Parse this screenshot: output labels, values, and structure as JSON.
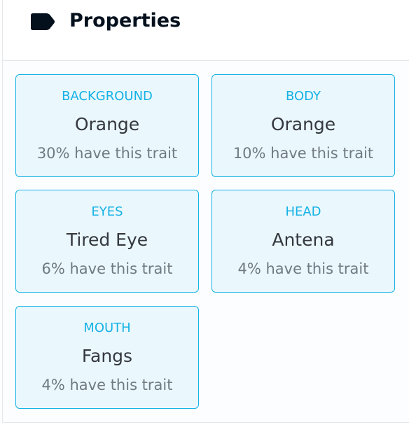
{
  "header": {
    "title": "Properties",
    "icon": "tag-icon",
    "icon_color": "#04111d"
  },
  "colors": {
    "accent": "#15b2e5",
    "card_background": "#eaf7fc",
    "value_text": "#353840",
    "rarity_text": "#707a83"
  },
  "traits": [
    {
      "type": "BACKGROUND",
      "value": "Orange",
      "rarity": "30% have this trait"
    },
    {
      "type": "BODY",
      "value": "Orange",
      "rarity": "10% have this trait"
    },
    {
      "type": "EYES",
      "value": "Tired Eye",
      "rarity": "6% have this trait"
    },
    {
      "type": "HEAD",
      "value": "Antena",
      "rarity": "4% have this trait"
    },
    {
      "type": "MOUTH",
      "value": "Fangs",
      "rarity": "4% have this trait"
    }
  ]
}
